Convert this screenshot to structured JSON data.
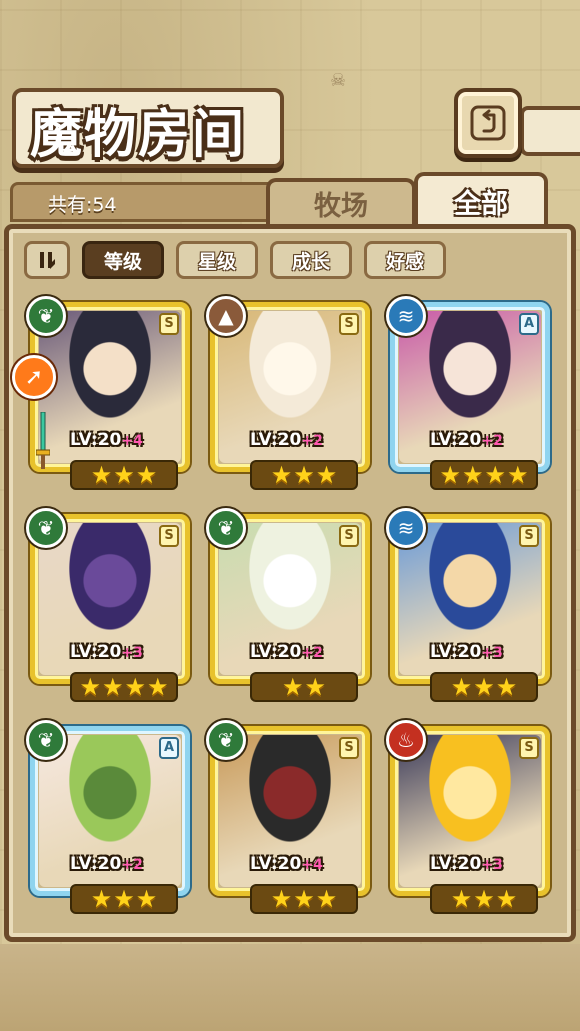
{
  "header": {
    "title": "魔物房间",
    "back_icon": "return-arrow-icon"
  },
  "count": {
    "label": "共有:54"
  },
  "tabs": [
    {
      "label": "牧场",
      "active": false
    },
    {
      "label": "全部",
      "active": true
    }
  ],
  "sort": {
    "toggle_icon": "pause-sort-icon",
    "options": [
      {
        "label": "等级",
        "active": true
      },
      {
        "label": "星级",
        "active": false
      },
      {
        "label": "成长",
        "active": false
      },
      {
        "label": "好感",
        "active": false
      }
    ]
  },
  "monsters": [
    {
      "element": "wood",
      "rank": "S",
      "frame": "gold",
      "level": "LV:20",
      "plus": "+4",
      "stars": 3,
      "art": [
        "#2a2a3a",
        "#6a5a7a",
        "#f4e0c8"
      ]
    },
    {
      "element": "earth",
      "rank": "S",
      "frame": "gold",
      "level": "LV:20",
      "plus": "+2",
      "stars": 3,
      "art": [
        "#f4ead8",
        "#d8b878",
        "#fff8ea"
      ]
    },
    {
      "element": "water",
      "rank": "A",
      "frame": "blue",
      "level": "LV:20",
      "plus": "+2",
      "stars": 4,
      "art": [
        "#3a2a4a",
        "#c85aa8",
        "#f6e4d8"
      ]
    },
    {
      "element": "wood",
      "rank": "S",
      "frame": "gold",
      "level": "LV:20",
      "plus": "+3",
      "stars": 4,
      "art": [
        "#3a2a6a",
        "#e8d8c8",
        "#6a4a9a"
      ]
    },
    {
      "element": "wood",
      "rank": "S",
      "frame": "gold",
      "level": "LV:20",
      "plus": "+2",
      "stars": 2,
      "art": [
        "#eef2e0",
        "#c8dcb0",
        "#ffffff"
      ]
    },
    {
      "element": "water",
      "rank": "S",
      "frame": "gold",
      "level": "LV:20",
      "plus": "+3",
      "stars": 3,
      "art": [
        "#2a4a9a",
        "#6a9ad8",
        "#f4d8a8"
      ]
    },
    {
      "element": "wood",
      "rank": "A",
      "frame": "blue",
      "level": "LV:20",
      "plus": "+2",
      "stars": 3,
      "art": [
        "#9ac85a",
        "#f6e8e0",
        "#5a8a3a"
      ]
    },
    {
      "element": "wood",
      "rank": "S",
      "frame": "gold",
      "level": "LV:20",
      "plus": "+4",
      "stars": 3,
      "art": [
        "#2a2a2a",
        "#c89a5a",
        "#8a2a2a"
      ]
    },
    {
      "element": "fire",
      "rank": "S",
      "frame": "gold",
      "level": "LV:20",
      "plus": "+3",
      "stars": 3,
      "art": [
        "#f8c020",
        "#3a3a5a",
        "#ffe8a0"
      ]
    }
  ],
  "extras": {
    "side_badge_icon": "skill-arrow-icon",
    "sword_icon": "sword-icon"
  }
}
